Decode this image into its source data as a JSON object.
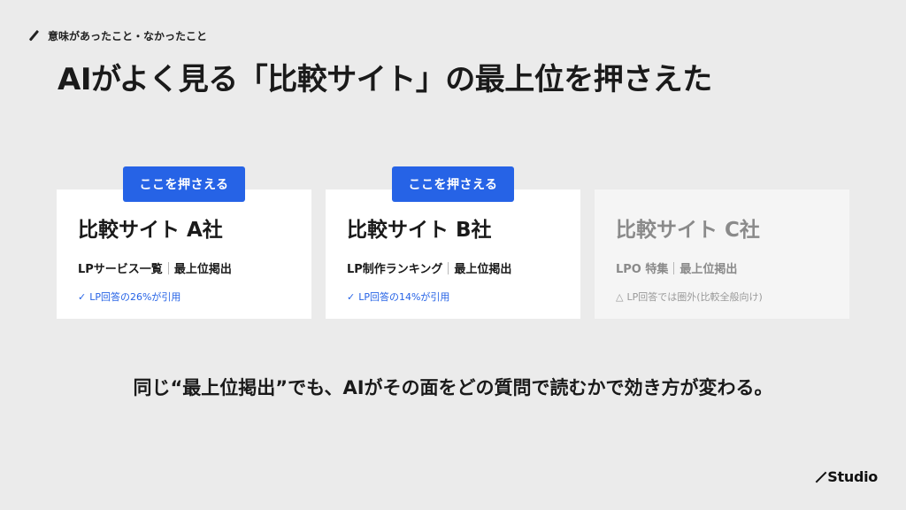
{
  "eyebrow": {
    "icon": "slash-icon",
    "text": "意味があったこと・なかったこと"
  },
  "title": "AIがよく見る「比較サイト」の最上位を押さえた",
  "cards": [
    {
      "badge": "ここを押さえる",
      "name": "比較サイト A社",
      "meta_left": "LPサービス一覧",
      "meta_right": "最上位掲出",
      "note_icon": "✓",
      "note": "LP回答の26%が引用",
      "highlighted": true
    },
    {
      "badge": "ここを押さえる",
      "name": "比較サイト B社",
      "meta_left": "LP制作ランキング",
      "meta_right": "最上位掲出",
      "note_icon": "✓",
      "note": "LP回答の14%が引用",
      "highlighted": true
    },
    {
      "name": "比較サイト C社",
      "meta_left": "LPO 特集",
      "meta_right": "最上位掲出",
      "note_icon": "△",
      "note": "LP回答では圏外(比較全般向け)",
      "highlighted": false
    }
  ],
  "summary": "同じ“最上位掲出”でも、AIがその面をどの質問で読むかで効き方が変わる。",
  "brand": "Studio",
  "colors": {
    "background": "#ebebeb",
    "accent": "#2663e6",
    "card": "#ffffff",
    "card_dim": "#f5f5f5",
    "muted_text": "#8a8a8a"
  }
}
